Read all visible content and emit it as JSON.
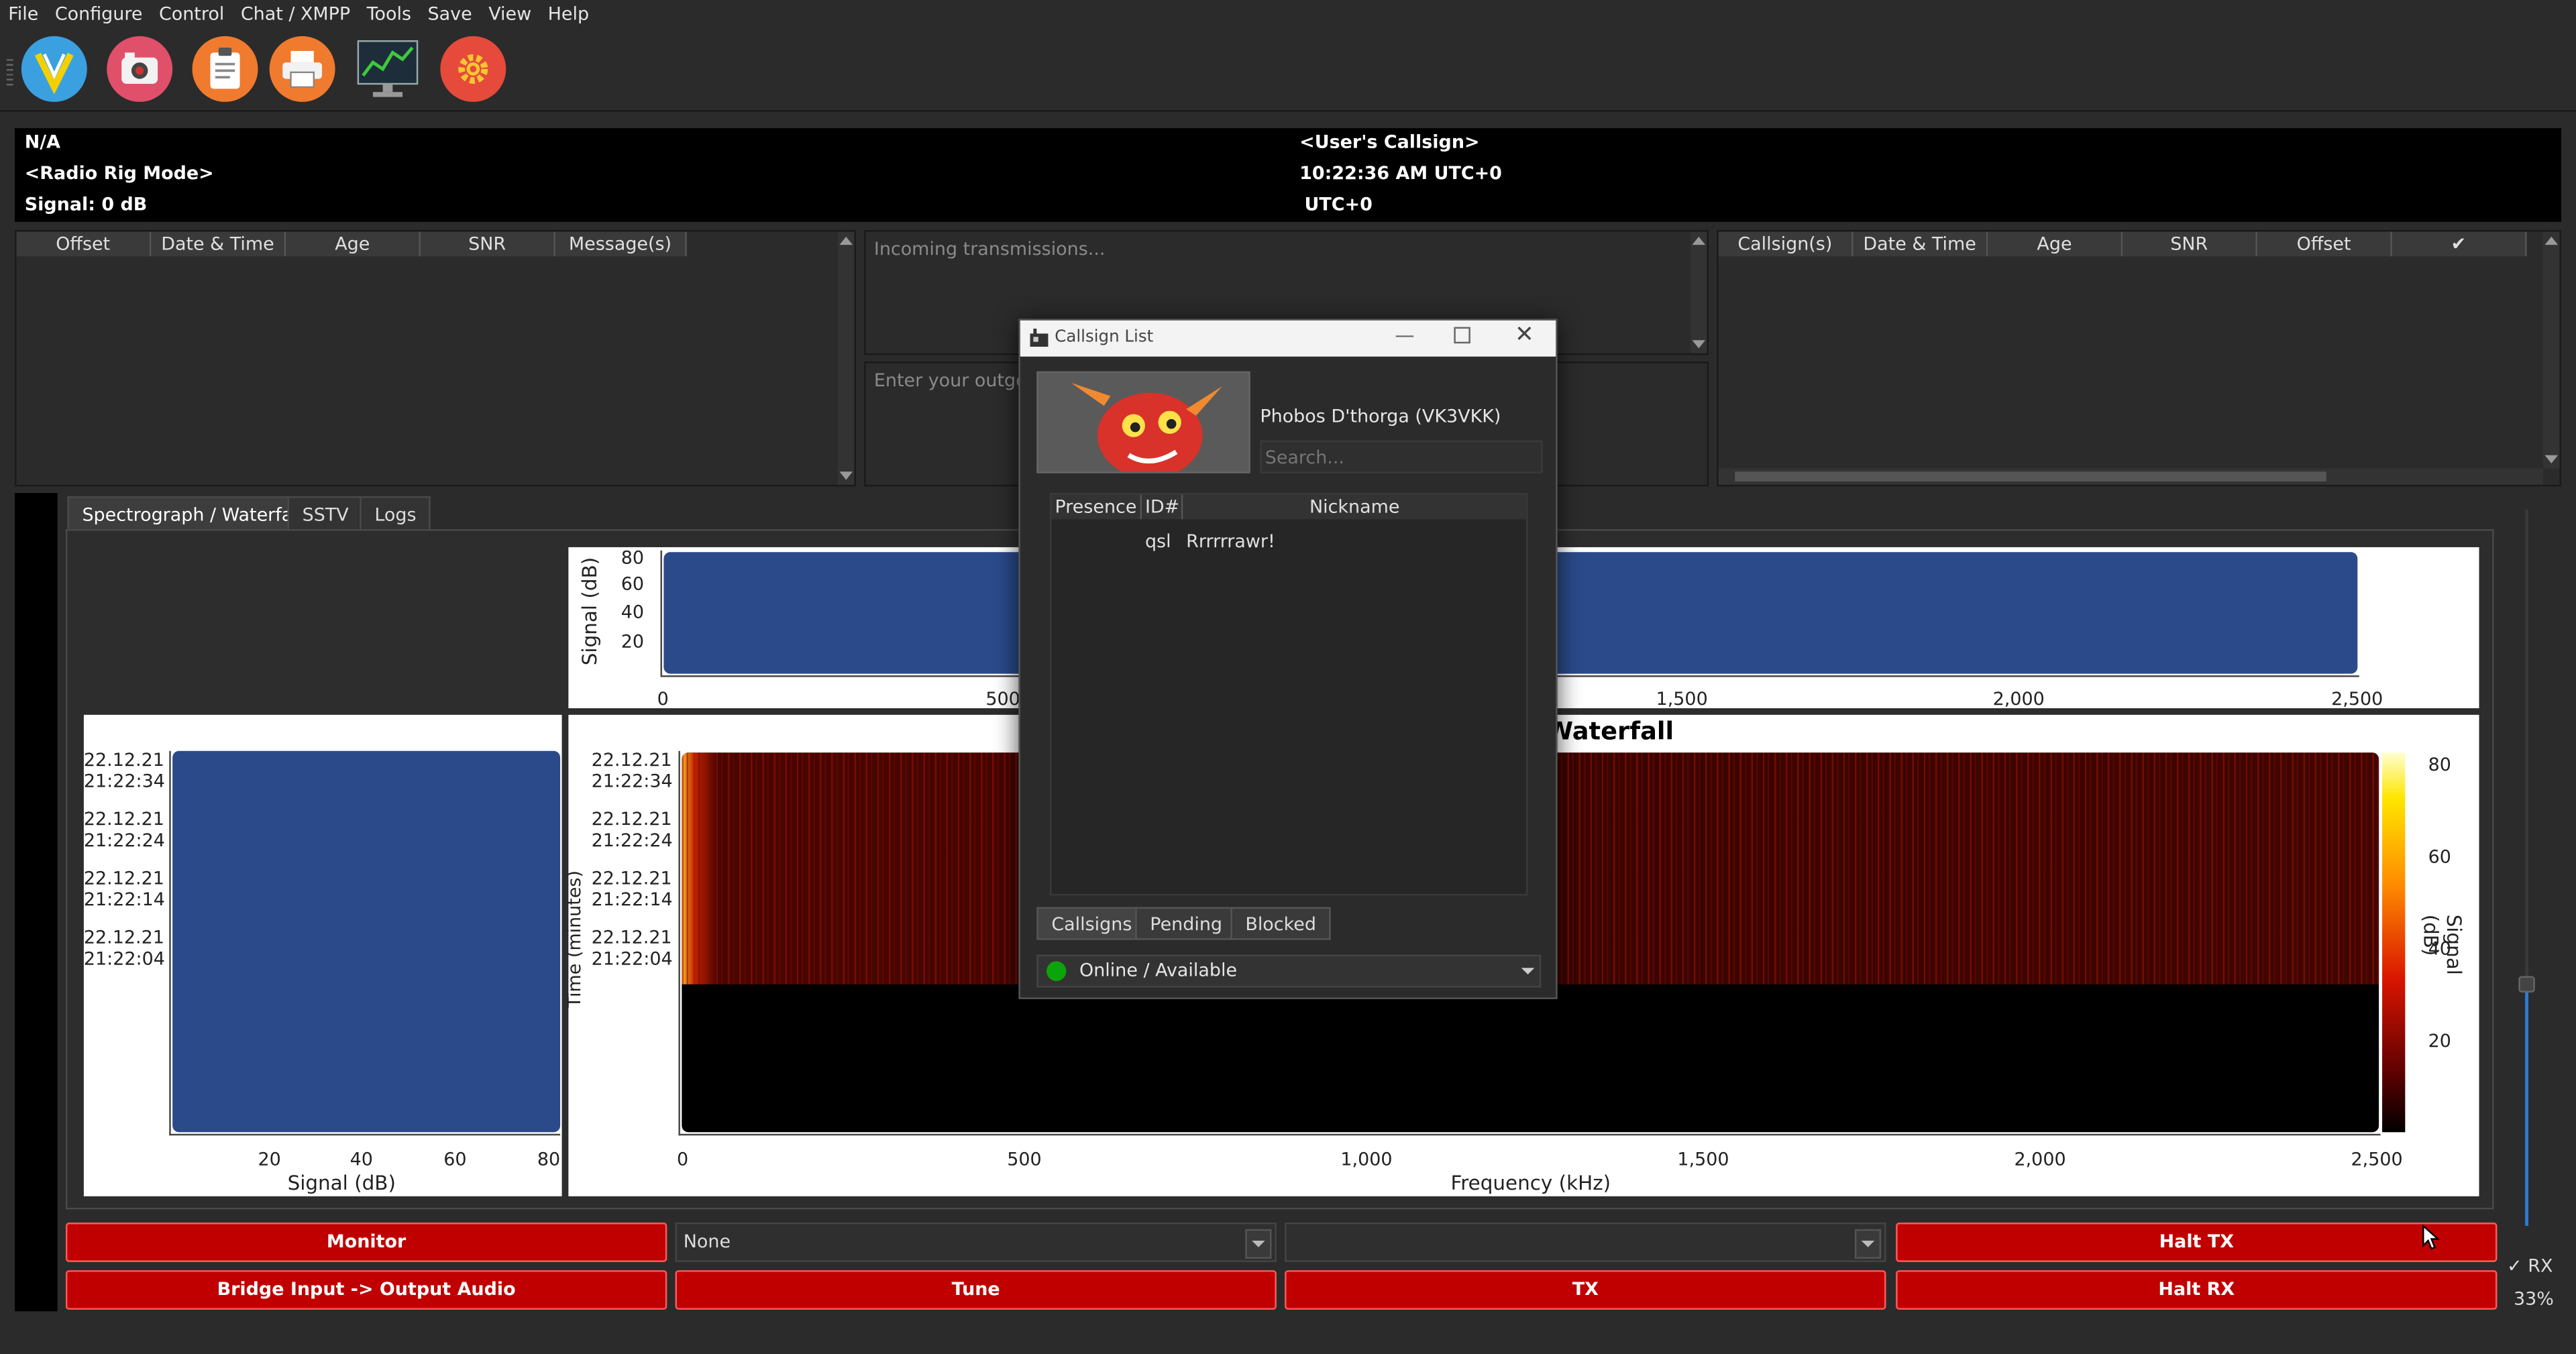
{
  "menu": [
    "File",
    "Configure",
    "Control",
    "Chat / XMPP",
    "Tools",
    "Save",
    "View",
    "Help"
  ],
  "toolbar_icons": [
    "logo-icon",
    "camera-icon",
    "clipboard-icon",
    "printer-icon",
    "chart-icon",
    "gear-icon"
  ],
  "info": {
    "frequency": "N/A",
    "rig_mode": "<Radio Rig Mode>",
    "signal": "Signal: 0 dB",
    "callsign": "<User's Callsign>",
    "time": "10:22:36 AM UTC+0",
    "timezone": "UTC+0"
  },
  "left_table": {
    "columns": [
      "Offset",
      "Date & Time",
      "Age",
      "SNR",
      "Message(s)"
    ]
  },
  "incoming_hint": "Incoming transmissions...",
  "outgoing_hint": "Enter your outgoing",
  "right_table": {
    "columns": [
      "Callsign(s)",
      "Date & Time",
      "Age",
      "SNR",
      "Offset",
      "✔"
    ]
  },
  "tabs": [
    "Spectrograph / Waterfall",
    "SSTV",
    "Logs"
  ],
  "top_plot": {
    "ylabel": "Signal (dB)",
    "yticks": [
      "80",
      "60",
      "40",
      "20"
    ],
    "xticks": [
      "0",
      "500",
      "1,500",
      "2,000",
      "2,500"
    ]
  },
  "left_plot": {
    "xlabel": "Signal (dB)",
    "xticks": [
      "20",
      "40",
      "60",
      "80"
    ],
    "yticks": [
      [
        "22.12.21",
        "21:22:34"
      ],
      [
        "22.12.21",
        "21:22:24"
      ],
      [
        "22.12.21",
        "21:22:14"
      ],
      [
        "22.12.21",
        "21:22:04"
      ]
    ]
  },
  "waterfall": {
    "title": "Waterfall",
    "xlabel": "Frequency (kHz)",
    "ylabel": "Time (minutes)",
    "cbar_label": "Signal (dB)",
    "xticks": [
      "0",
      "500",
      "1,000",
      "1,500",
      "2,000",
      "2,500"
    ],
    "yticks": [
      [
        "22.12.21",
        "21:22:34"
      ],
      [
        "22.12.21",
        "21:22:24"
      ],
      [
        "22.12.21",
        "21:22:14"
      ],
      [
        "22.12.21",
        "21:22:04"
      ]
    ],
    "cbar_ticks": [
      "80",
      "60",
      "40",
      "20"
    ]
  },
  "buttons": {
    "monitor": "Monitor",
    "bridge": "Bridge Input -> Output Audio",
    "tune": "Tune",
    "tx": "TX",
    "halt_tx": "Halt TX",
    "halt_rx": "Halt RX"
  },
  "combo1": "None",
  "combo2": "",
  "rx_check": "✓ RX",
  "volume": "33%",
  "colors": {
    "accent_red": "#c00000",
    "plot_blue": "#2b4a8a",
    "status_green": "#0ca40c"
  },
  "dialog": {
    "title": "Callsign List",
    "user": "Phobos D'thorga (VK3VKK)",
    "search_placeholder": "Search...",
    "columns": [
      "Presence",
      "ID#",
      "Nickname"
    ],
    "rows": [
      {
        "presence": "",
        "id": "qsl",
        "nickname": "Rrrrrrawr!"
      }
    ],
    "tabs": [
      "Callsigns",
      "Pending",
      "Blocked"
    ],
    "status": "Online / Available"
  }
}
